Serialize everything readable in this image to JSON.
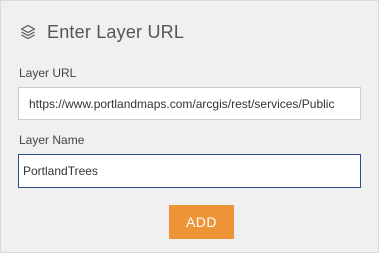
{
  "panel": {
    "title": "Enter Layer URL",
    "title_icon": "layers-icon"
  },
  "layer_url": {
    "label": "Layer URL",
    "value": "https://www.portlandmaps.com/arcgis/rest/services/Public",
    "visible_value": "https://www.portlandmaps.com/arcgis/rest/services/Publi"
  },
  "layer_name": {
    "label": "Layer Name",
    "value": "PortlandTrees"
  },
  "add_button": {
    "label": "ADD"
  },
  "colors": {
    "panel_bg": "#f0f0f0",
    "accent_button": "#ec9436",
    "focused_border": "#2b4f8a"
  }
}
